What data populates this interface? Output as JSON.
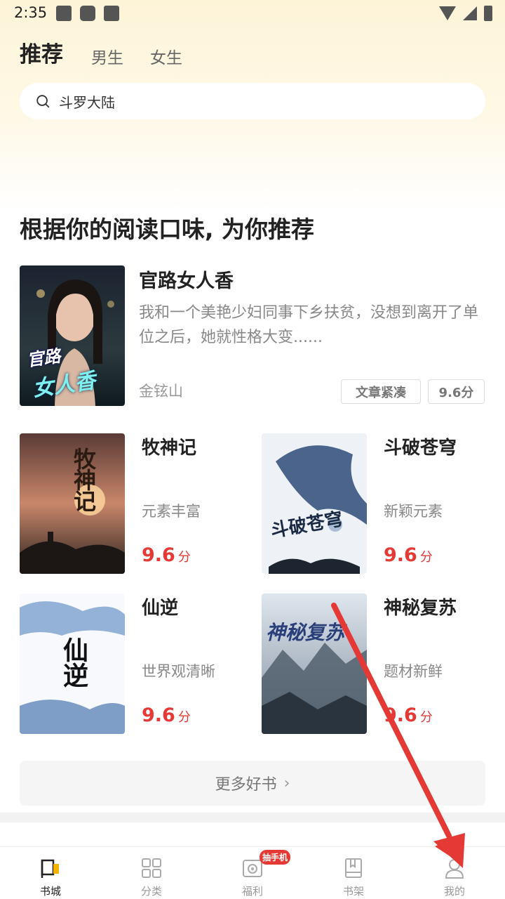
{
  "status_bar": {
    "time": "2:35"
  },
  "tabs": [
    {
      "label": "推荐",
      "active": true
    },
    {
      "label": "男生",
      "active": false
    },
    {
      "label": "女生",
      "active": false
    }
  ],
  "search": {
    "text": "斗罗大陆"
  },
  "section_title": "根据你的阅读口味, 为你推荐",
  "featured": {
    "title": "官路女人香",
    "description": "我和一个美艳少妇同事下乡扶贫，没想到离开了单位之后，她就性格大变......",
    "author": "金铉山",
    "tags": [
      "文章紧凑",
      "9.6分"
    ],
    "cover_text": [
      "官路",
      "女人香"
    ]
  },
  "books": [
    {
      "title": "牧神记",
      "tag": "元素丰富",
      "score": "9.6",
      "unit": "分",
      "cover_text": "牧神记"
    },
    {
      "title": "斗破苍穹",
      "tag": "新颖元素",
      "score": "9.6",
      "unit": "分",
      "cover_text": "斗破苍穹"
    },
    {
      "title": "仙逆",
      "tag": "世界观清晰",
      "score": "9.6",
      "unit": "分",
      "cover_text": "仙逆"
    },
    {
      "title": "神秘复苏",
      "tag": "题材新鲜",
      "score": "9.6",
      "unit": "分",
      "cover_text": "神秘复苏"
    }
  ],
  "more_button": {
    "label": "更多好书",
    "chevron": "›"
  },
  "bottom_nav": [
    {
      "label": "书城",
      "icon": "bookstore-icon",
      "active": true
    },
    {
      "label": "分类",
      "icon": "category-icon",
      "active": false
    },
    {
      "label": "福利",
      "icon": "gift-icon",
      "active": false,
      "badge": "抽手机"
    },
    {
      "label": "书架",
      "icon": "bookshelf-icon",
      "active": false
    },
    {
      "label": "我的",
      "icon": "profile-icon",
      "active": false
    }
  ],
  "colors": {
    "accent_red": "#e53935",
    "header_bg": "#fdf4d8"
  }
}
